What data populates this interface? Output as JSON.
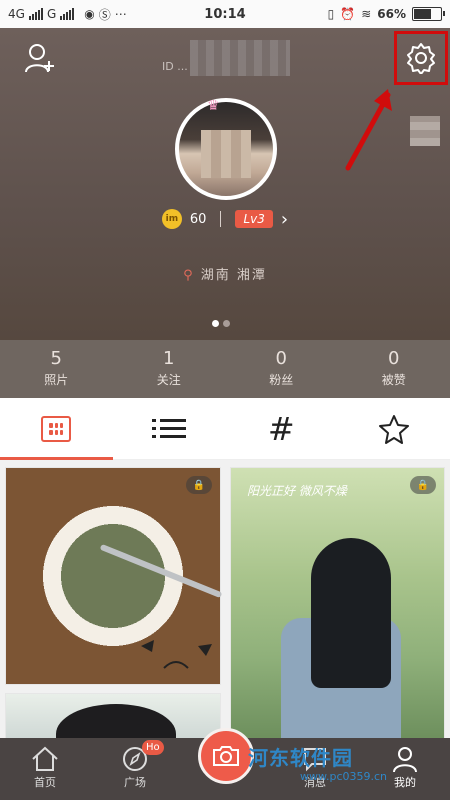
{
  "status_bar": {
    "left_text": [
      "4G",
      "G"
    ],
    "time": "10:14",
    "battery_percent": "66%",
    "battery_level": 0.66
  },
  "profile": {
    "add_friend_icon": "add-user-icon",
    "settings_icon": "gear-icon",
    "level_coins": "60",
    "level_label": "Lv3",
    "location": "湖南 湘潭",
    "username_sub": "ID ..."
  },
  "stats": [
    {
      "count": "5",
      "label": "照片"
    },
    {
      "count": "1",
      "label": "关注"
    },
    {
      "count": "0",
      "label": "粉丝"
    },
    {
      "count": "0",
      "label": "被赞"
    }
  ],
  "tabs": [
    {
      "icon": "grid-icon",
      "active": true
    },
    {
      "icon": "list-icon",
      "active": false
    },
    {
      "icon": "hashtag-icon",
      "active": false
    },
    {
      "icon": "star-icon",
      "active": false
    }
  ],
  "photo_text": {
    "p2_poem": "阳光正好 微风不燥"
  },
  "bottom_nav": {
    "home": "首页",
    "square": "广场",
    "hot_badge": "Ho",
    "messages": "消息",
    "mine": "我的"
  },
  "watermark": {
    "title": "河东软件园",
    "url": "www.pc0359.cn"
  },
  "colors": {
    "accent": "#e95a45",
    "highlight_box": "#d10c0c",
    "profile_bg": "#5e514c"
  }
}
